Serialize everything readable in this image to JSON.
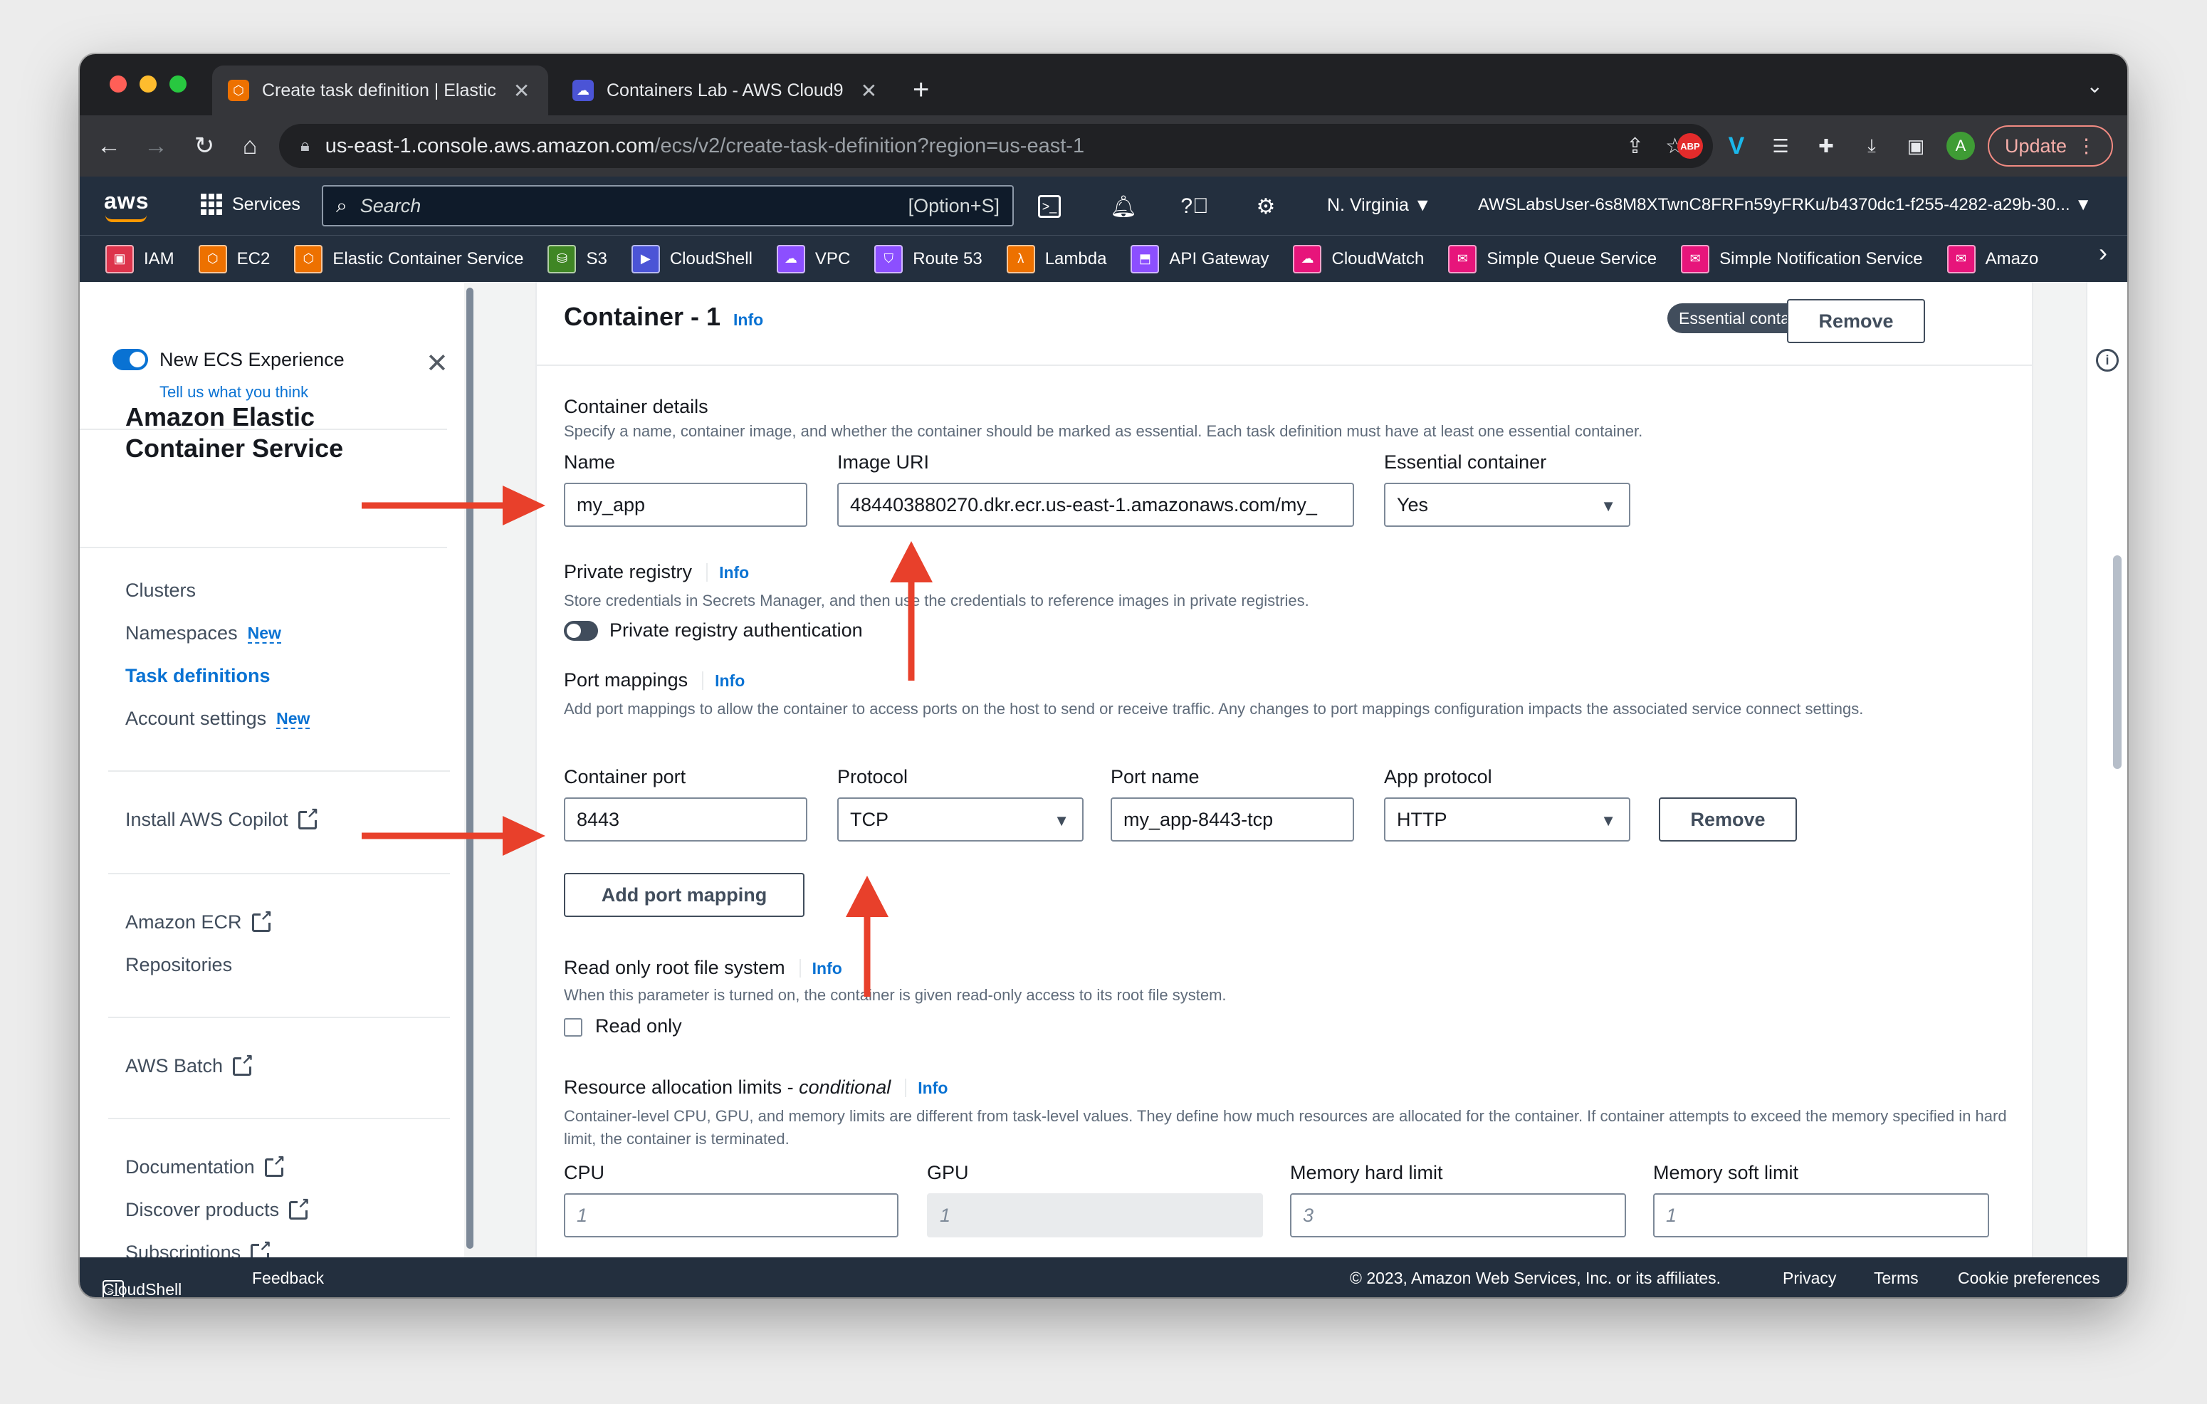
{
  "browser": {
    "tabs": [
      {
        "title": "Create task definition | Elastic",
        "close": "✕"
      },
      {
        "title": "Containers Lab - AWS Cloud9",
        "close": "✕"
      }
    ],
    "new_tab": "+",
    "url_host": "us-east-1.console.aws.amazon.com",
    "url_path": "/ecs/v2/create-task-definition?region=us-east-1",
    "update_label": "Update",
    "abp_label": "ABP",
    "profile_initial": "A"
  },
  "aws_header": {
    "logo": "aws",
    "services_label": "Services",
    "search_placeholder": "Search",
    "search_shortcut": "[Option+S]",
    "region": "N. Virginia ▼",
    "account": "AWSLabsUser-6s8M8XTwnC8FRFn59yFRKu/b4370dc1-f255-4282-a29b-30... ▼"
  },
  "favorites": [
    {
      "label": "IAM",
      "color": "#dd344c"
    },
    {
      "label": "EC2",
      "color": "#ed7100"
    },
    {
      "label": "Elastic Container Service",
      "color": "#ed7100"
    },
    {
      "label": "S3",
      "color": "#3f8624"
    },
    {
      "label": "CloudShell",
      "color": "#4b54d6"
    },
    {
      "label": "VPC",
      "color": "#8c4fff"
    },
    {
      "label": "Route 53",
      "color": "#8c4fff"
    },
    {
      "label": "Lambda",
      "color": "#ed7100"
    },
    {
      "label": "API Gateway",
      "color": "#8c4fff"
    },
    {
      "label": "CloudWatch",
      "color": "#e7157b"
    },
    {
      "label": "Simple Queue Service",
      "color": "#e7157b"
    },
    {
      "label": "Simple Notification Service",
      "color": "#e7157b"
    },
    {
      "label": "Amazo",
      "color": "#e7157b"
    }
  ],
  "sidebar": {
    "experience_label": "New ECS Experience",
    "feedback_link": "Tell us what you think",
    "title": "Amazon Elastic Container Service",
    "nav": [
      {
        "label": "Clusters"
      },
      {
        "label": "Namespaces",
        "badge": "New"
      },
      {
        "label": "Task definitions"
      },
      {
        "label": "Account settings",
        "badge": "New"
      }
    ],
    "copilot": "Install AWS Copilot",
    "ecr": "Amazon ECR",
    "repositories": "Repositories",
    "batch": "AWS Batch",
    "documentation": "Documentation",
    "discover": "Discover products",
    "subscriptions": "Subscriptions"
  },
  "container": {
    "title": "Container - 1",
    "info": "Info",
    "essential_badge": "Essential container",
    "remove_label": "Remove",
    "details_heading": "Container details",
    "details_desc": "Specify a name, container image, and whether the container should be marked as essential. Each task definition must have at least one essential container.",
    "name_label": "Name",
    "name_value": "my_app",
    "image_label": "Image URI",
    "image_value": "484403880270.dkr.ecr.us-east-1.amazonaws.com/my_",
    "essential_label": "Essential container",
    "essential_value": "Yes",
    "private_registry_heading": "Private registry",
    "private_registry_desc": "Store credentials in Secrets Manager, and then use the credentials to reference images in private registries.",
    "private_registry_toggle": "Private registry authentication",
    "port_heading": "Port mappings",
    "port_desc": "Add port mappings to allow the container to access ports on the host to send or receive traffic. Any changes to port mappings configuration impacts the associated service connect settings.",
    "container_port_label": "Container port",
    "container_port_value": "8443",
    "protocol_label": "Protocol",
    "protocol_value": "TCP",
    "port_name_label": "Port name",
    "port_name_value": "my_app-8443-tcp",
    "app_protocol_label": "App protocol",
    "app_protocol_value": "HTTP",
    "add_port_label": "Add port mapping",
    "readonly_heading": "Read only root file system",
    "readonly_desc": "When this parameter is turned on, the container is given read-only access to its root file system.",
    "readonly_checkbox": "Read only",
    "resource_heading": "Resource allocation limits - ",
    "resource_heading_em": "conditional",
    "resource_desc": "Container-level CPU, GPU, and memory limits are different from task-level values. They define how much resources are allocated for the container. If container attempts to exceed the memory specified in hard limit, the container is terminated.",
    "cpu_label": "CPU",
    "cpu_placeholder": "1",
    "gpu_label": "GPU",
    "gpu_placeholder": "1",
    "mem_hard_label": "Memory hard limit",
    "mem_hard_placeholder": "3",
    "mem_soft_label": "Memory soft limit",
    "mem_soft_placeholder": "1"
  },
  "footer": {
    "cloudshell": "CloudShell",
    "feedback": "Feedback",
    "copyright": "© 2023, Amazon Web Services, Inc. or its affiliates.",
    "privacy": "Privacy",
    "terms": "Terms",
    "cookies": "Cookie preferences"
  },
  "colors": {
    "accent": "#0972d3",
    "annotation": "#e8402b",
    "aws_nav": "#232f3e"
  }
}
